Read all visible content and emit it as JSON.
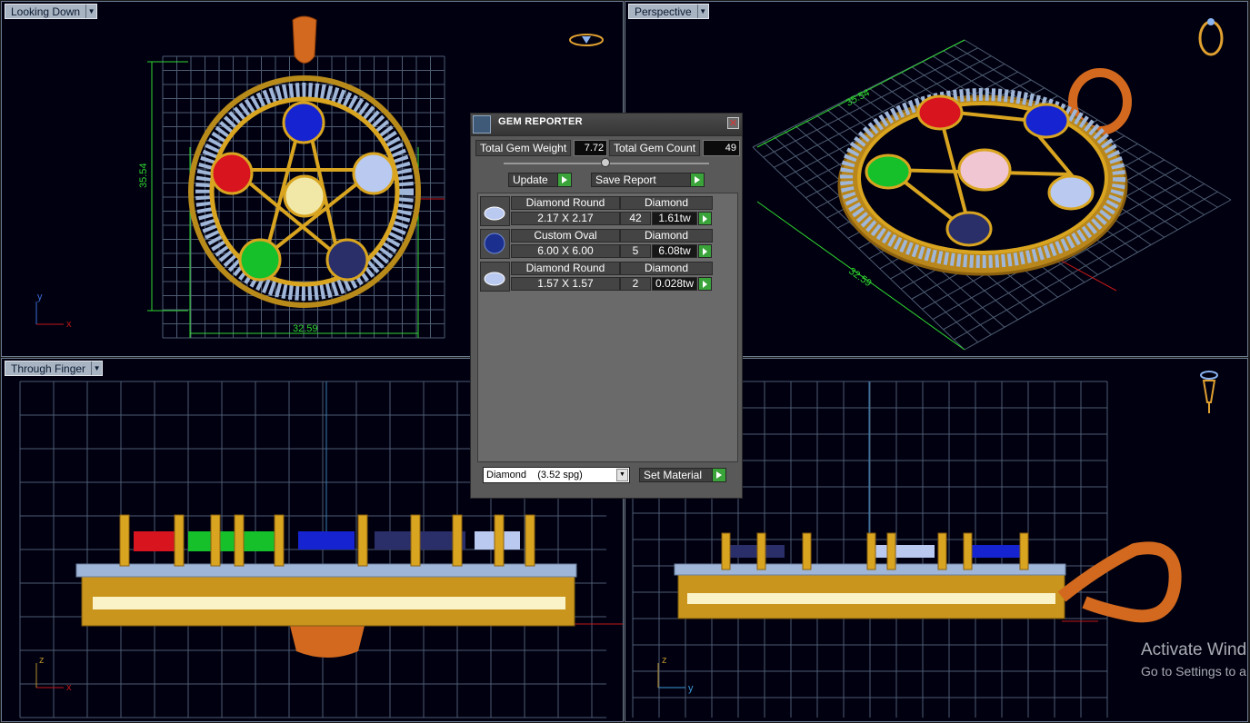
{
  "viewports": {
    "top_left": {
      "label": "Looking Down",
      "dim_vertical": "35.54",
      "dim_horizontal": "32.59",
      "axis_v": "y",
      "axis_h": "x"
    },
    "top_right": {
      "label": "Perspective",
      "dim_a": "35.54",
      "dim_b": "32.59"
    },
    "bottom_left": {
      "label": "Through Finger",
      "axis_v": "z",
      "axis_h": "x"
    },
    "bottom_right": {
      "axis_v": "z",
      "axis_h": "y"
    }
  },
  "gem_reporter": {
    "title": "GEM REPORTER",
    "total_weight_label": "Total Gem Weight",
    "total_weight_value": "7.72",
    "total_count_label": "Total Gem Count",
    "total_count_value": "49",
    "update_label": "Update",
    "save_report_label": "Save Report",
    "gems": [
      {
        "shape": "Diamond Round",
        "material": "Diamond",
        "size": "2.17 X 2.17",
        "count": "42",
        "weight": "1.61tw",
        "thumb_color": "#b9c9f0"
      },
      {
        "shape": "Custom Oval",
        "material": "Diamond",
        "size": "6.00 X 6.00",
        "count": "5",
        "weight": "6.08tw",
        "thumb_color": "#1b2f8f"
      },
      {
        "shape": "Diamond Round",
        "material": "Diamond",
        "size": "1.57 X 1.57",
        "count": "2",
        "weight": "0.028tw",
        "thumb_color": "#b9c9f0"
      }
    ],
    "material_select": "Diamond    (3.52 spg)",
    "set_material_label": "Set Material"
  },
  "watermark": {
    "line1": "Activate Wind",
    "line2": "Go to Settings to a"
  },
  "colors": {
    "viewport_bg": "#000010",
    "grid": "#5a6b80",
    "gold": "#d9a520",
    "dimension": "#2fd62f",
    "gem_red": "#d8141e",
    "gem_blue": "#1524d0",
    "gem_green": "#15c02a",
    "gem_light": "#b9c9f0",
    "gem_navy": "#2a2f6a",
    "gem_pink": "#f1c6d3"
  }
}
